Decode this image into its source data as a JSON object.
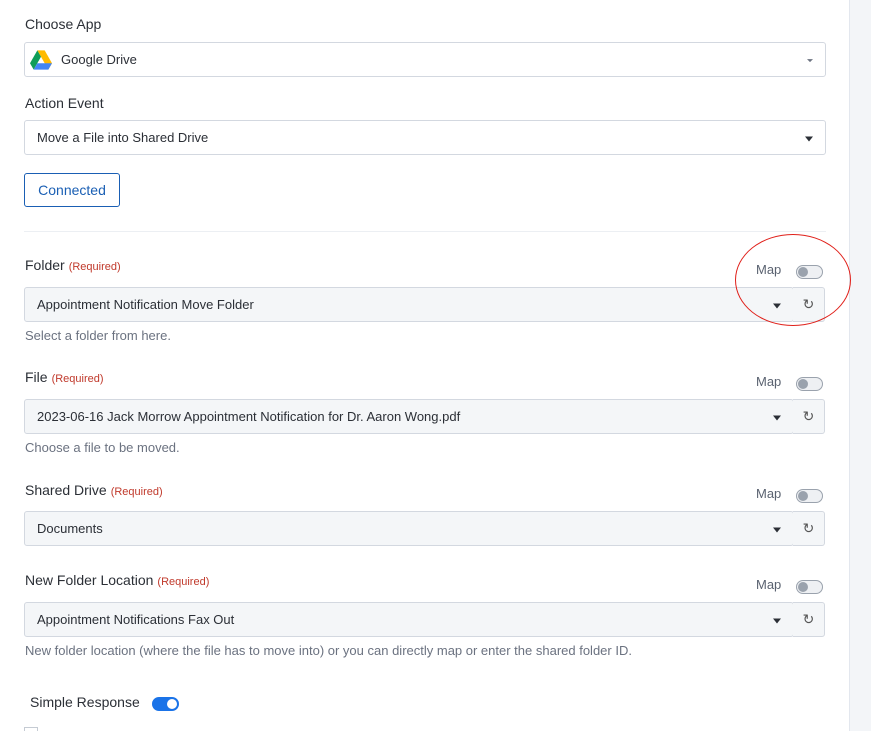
{
  "app": {
    "label": "Choose App",
    "value": "Google Drive"
  },
  "action": {
    "label": "Action Event",
    "value": "Move a File into Shared Drive"
  },
  "connected_button": "Connected",
  "required_tag": "(Required)",
  "map_label": "Map",
  "fields": [
    {
      "label": "Folder",
      "value": "Appointment Notification Move Folder",
      "help": "Select a folder from here."
    },
    {
      "label": "File",
      "value": "2023-06-16 Jack Morrow Appointment Notification for Dr. Aaron Wong.pdf",
      "help": "Choose a file to be moved."
    },
    {
      "label": "Shared Drive",
      "value": "Documents",
      "help": ""
    },
    {
      "label": "New Folder Location",
      "value": "Appointment Notifications Fax Out",
      "help": "New folder location (where the file has to move into) or you can directly map or enter the shared folder ID."
    }
  ],
  "simple_response": {
    "label": "Simple Response",
    "enabled": true
  },
  "colors": {
    "accent": "#1a73e8",
    "required": "#c0392b",
    "highlight_circle": "#e0201a"
  },
  "icons": {
    "app_logo": "google-drive-icon",
    "dropdown": "chevron-down-icon",
    "refresh": "refresh-icon"
  }
}
